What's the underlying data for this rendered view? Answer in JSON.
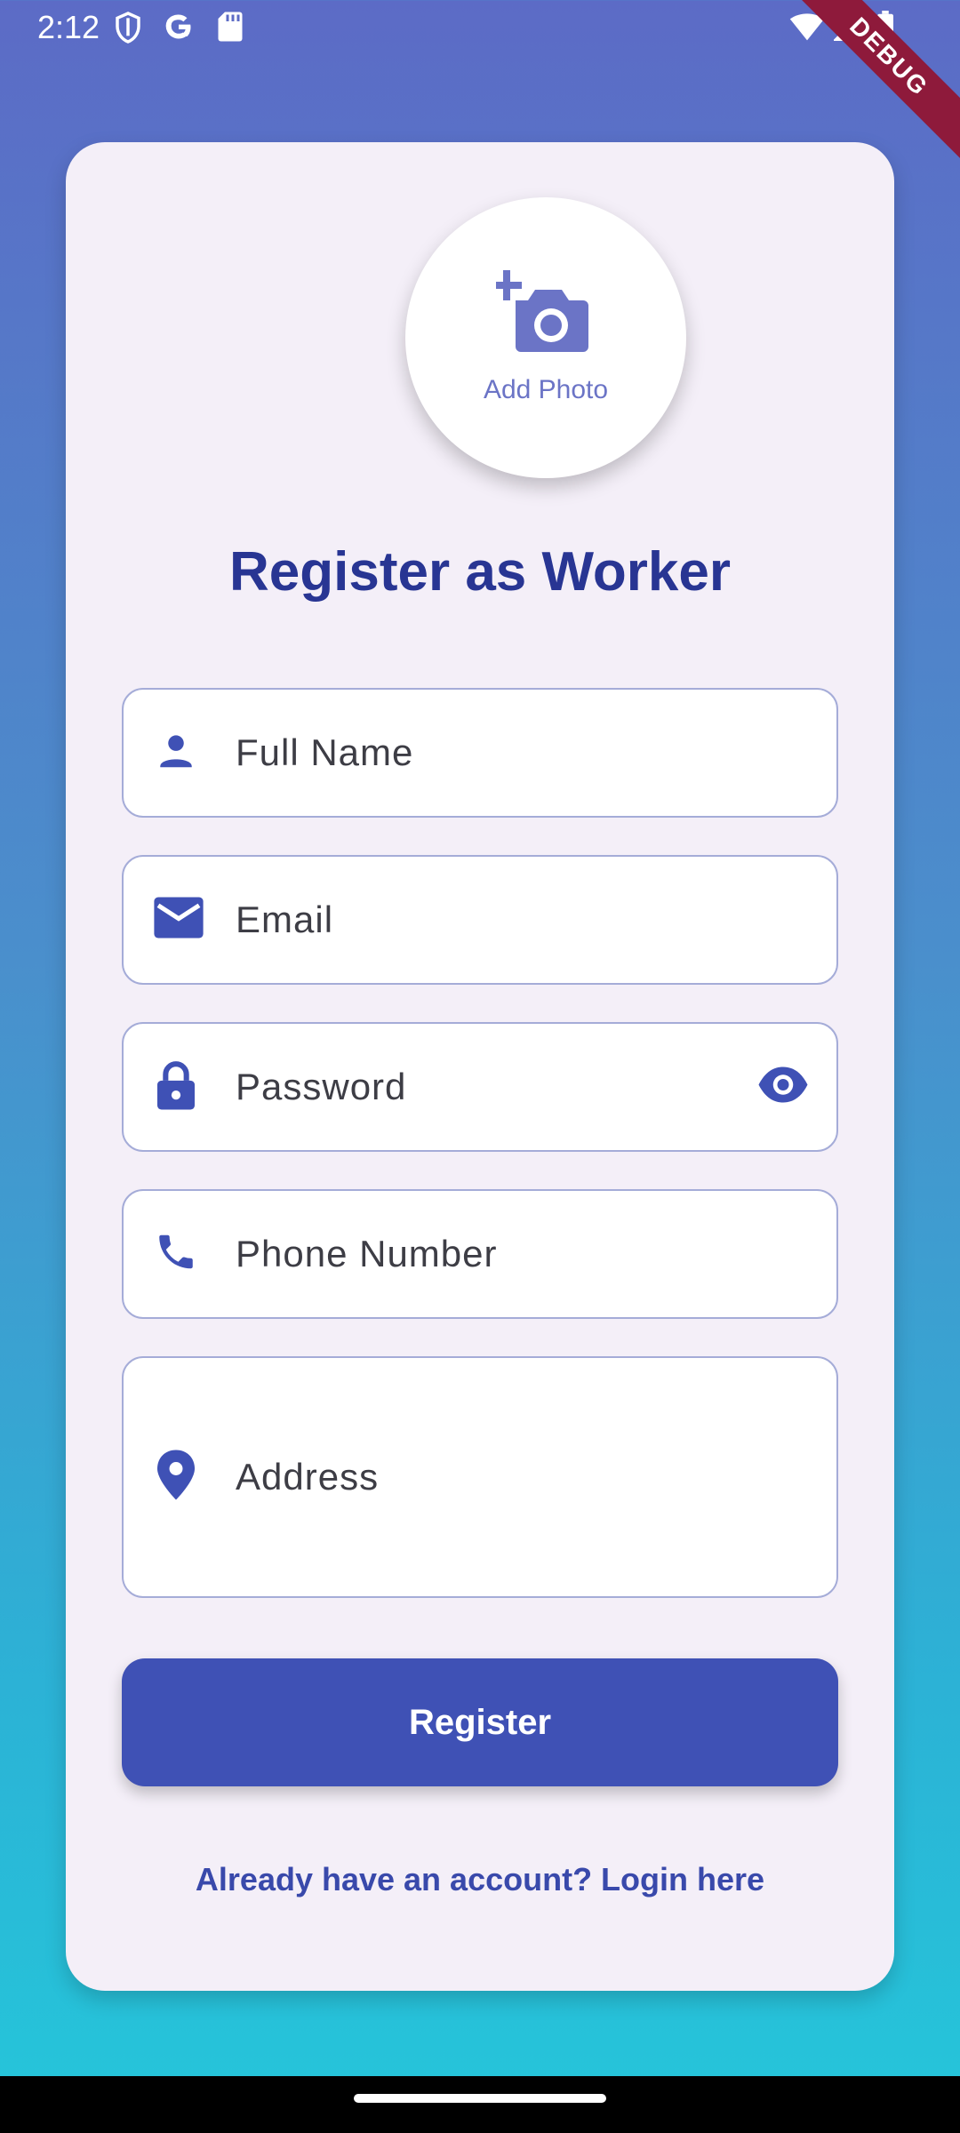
{
  "status_bar": {
    "time": "2:12",
    "left_icons": [
      "shield-icon",
      "google-icon",
      "sd-card-icon"
    ],
    "right_icons": [
      "wifi-icon",
      "signal-icon",
      "battery-icon"
    ],
    "debug_banner": "DEBUG"
  },
  "photo": {
    "label": "Add Photo",
    "icon": "add-a-photo-icon"
  },
  "title": "Register as Worker",
  "fields": [
    {
      "placeholder": "Full Name",
      "icon": "person-icon"
    },
    {
      "placeholder": "Email",
      "icon": "email-icon"
    },
    {
      "placeholder": "Password",
      "icon": "lock-icon",
      "trailing_icon": "visibility-icon"
    },
    {
      "placeholder": "Phone Number",
      "icon": "phone-icon"
    },
    {
      "placeholder": "Address",
      "icon": "location-pin-icon"
    }
  ],
  "register_button": "Register",
  "login_link": "Already have an account? Login here",
  "colors": {
    "primary": "#3f51b5",
    "title": "#283593",
    "card_background": "#f4eff8",
    "field_border": "#a5acd8",
    "gradient_top": "#5c6bc6",
    "gradient_bottom": "#25c6da"
  }
}
